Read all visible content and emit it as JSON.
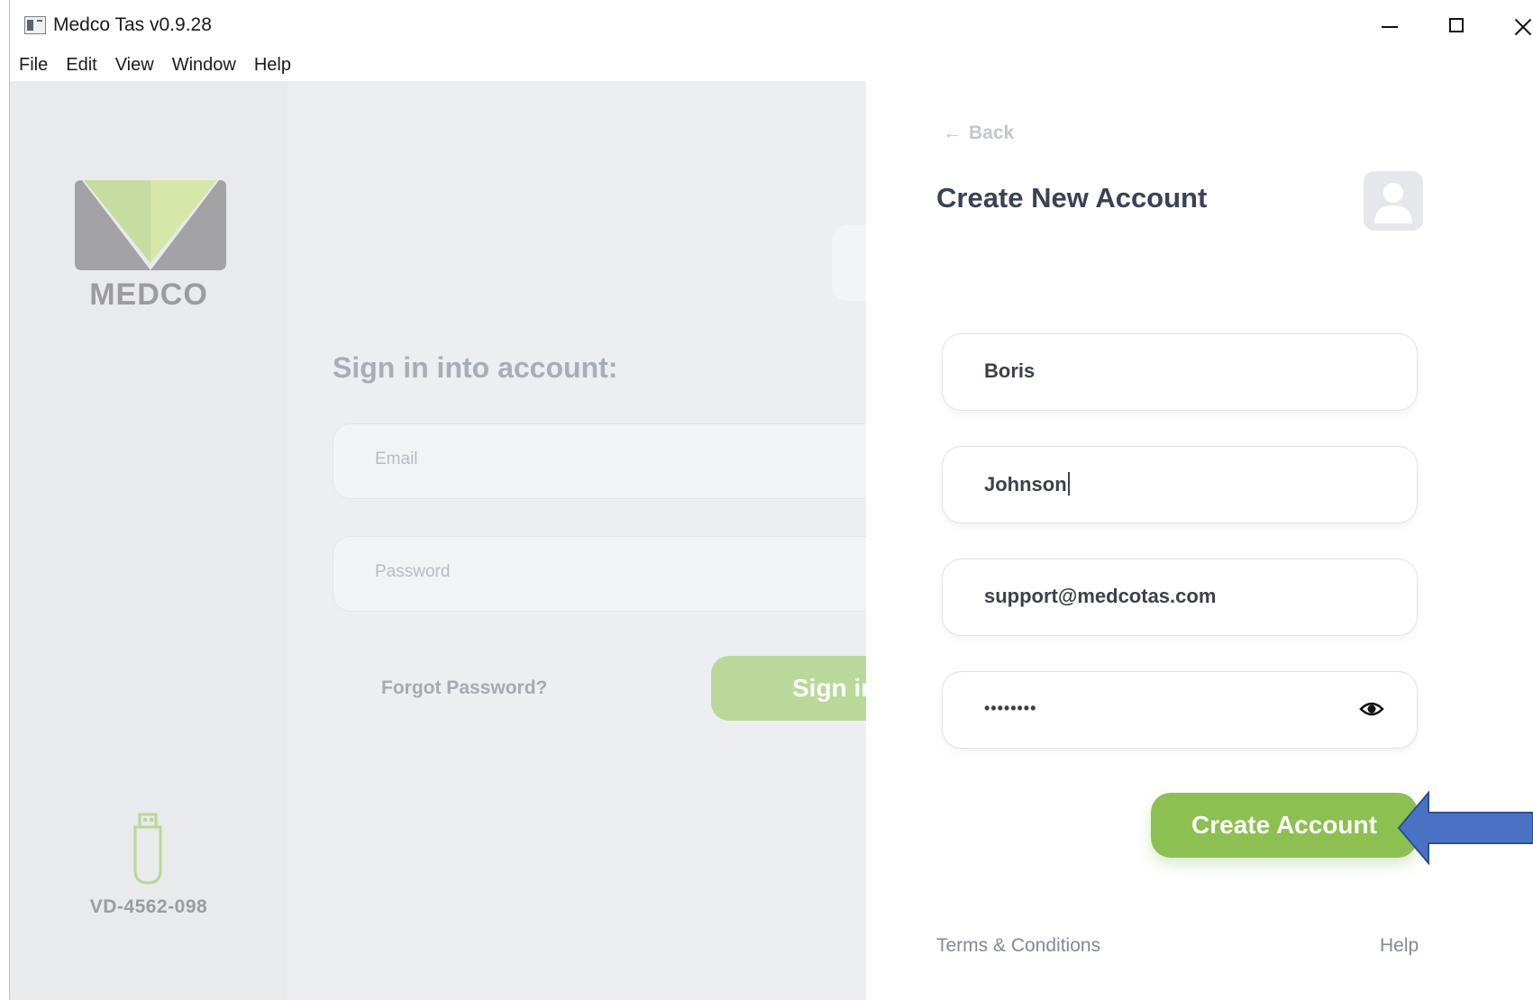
{
  "window": {
    "title": "Medco Tas v0.9.28",
    "menu": [
      "File",
      "Edit",
      "View",
      "Window",
      "Help"
    ]
  },
  "sidebar": {
    "logo_text": "MEDCO",
    "device_id": "VD-4562-098",
    "icons": [
      "medco-logo",
      "usb-drive-icon"
    ]
  },
  "signin": {
    "title": "Sign in into account:",
    "email_placeholder": "Email",
    "password_placeholder": "Password",
    "forgot_label": "Forgot Password?",
    "signin_label": "Sign in"
  },
  "panel": {
    "back_label": "Back",
    "title": "Create New Account",
    "first_name": "Boris",
    "last_name": "Johnson",
    "email": "support@medcotas.com",
    "password_masked": "••••••••",
    "create_label": "Create Account",
    "terms_label": "Terms & Conditions",
    "help_label": "Help"
  },
  "colors": {
    "accent_green": "#8cc051",
    "annotation_arrow": "#4a72c4",
    "title_text": "#3b4256"
  }
}
